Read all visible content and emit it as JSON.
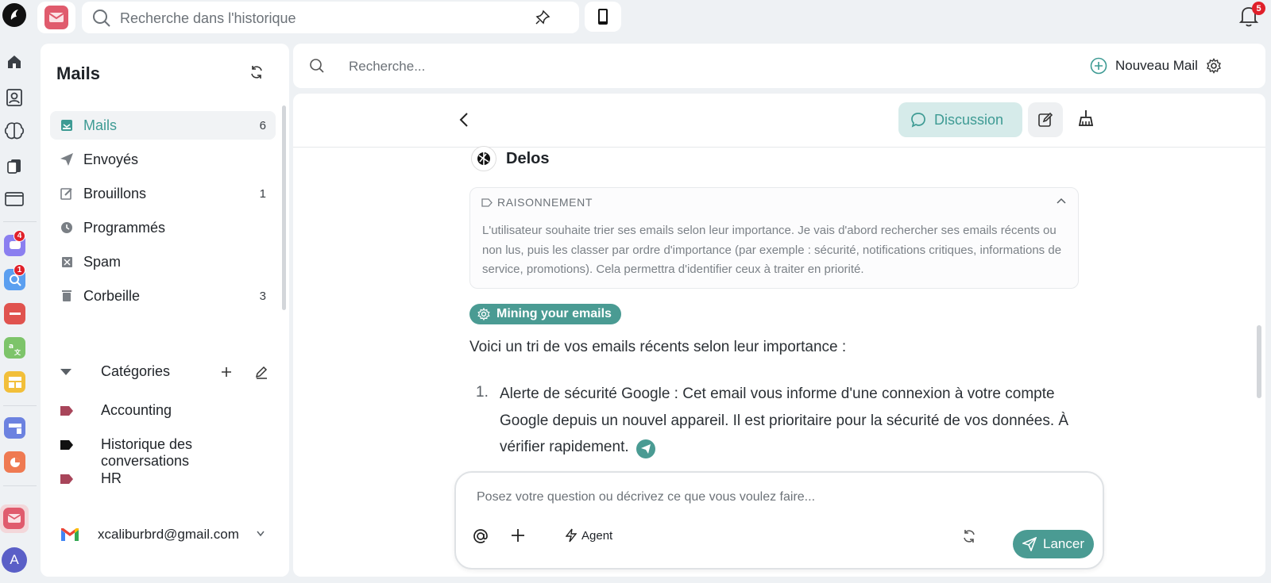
{
  "topbar": {
    "search_placeholder": "Recherche dans l'historique",
    "notification_count": "5"
  },
  "rail": {
    "badge_chat": "4",
    "badge_search": "1",
    "avatar_letter": "A"
  },
  "sidebar": {
    "title": "Mails",
    "folders": [
      {
        "label": "Mails",
        "count": "6"
      },
      {
        "label": "Envoyés",
        "count": ""
      },
      {
        "label": "Brouillons",
        "count": "1"
      },
      {
        "label": "Programmés",
        "count": ""
      },
      {
        "label": "Spam",
        "count": ""
      },
      {
        "label": "Corbeille",
        "count": "3"
      }
    ],
    "categories_title": "Catégories",
    "tags": [
      {
        "label": "Accounting",
        "color": "#a8455a"
      },
      {
        "label": "Historique des conversations",
        "color": "#111111"
      },
      {
        "label": "HR",
        "color": "#a8455a"
      }
    ],
    "account": "xcaliburbrd@gmail.com"
  },
  "main": {
    "search_placeholder": "Recherche...",
    "new_mail_label": "Nouveau Mail",
    "discussion_label": "Discussion",
    "sender_name": "Delos",
    "reasoning_title": "RAISONNEMENT",
    "reasoning_text": "L'utilisateur souhaite trier ses emails selon leur importance. Je vais d'abord rechercher ses emails récents ou non lus, puis les classer par ordre d'importance (par exemple : sécurité, notifications critiques, informations de service, promotions). Cela permettra d'identifier ceux à traiter en priorité.",
    "tool_pill": "Mining your emails",
    "intro": "Voici un tri de vos emails récents selon leur importance :",
    "list": [
      {
        "num": "1.",
        "text": "Alerte de sécurité Google : Cet email vous informe d'une connexion à votre compte Google depuis un nouvel appareil. Il est prioritaire pour la sécurité de vos données. À vérifier rapidement."
      }
    ]
  },
  "composer": {
    "placeholder": "Posez votre question ou décrivez ce que vous voulez faire...",
    "agent_label": "Agent",
    "send_label": "Lancer"
  },
  "colors": {
    "accent": "#4a9b93",
    "accent_light": "#d6ebea",
    "badge": "#e0202a"
  }
}
